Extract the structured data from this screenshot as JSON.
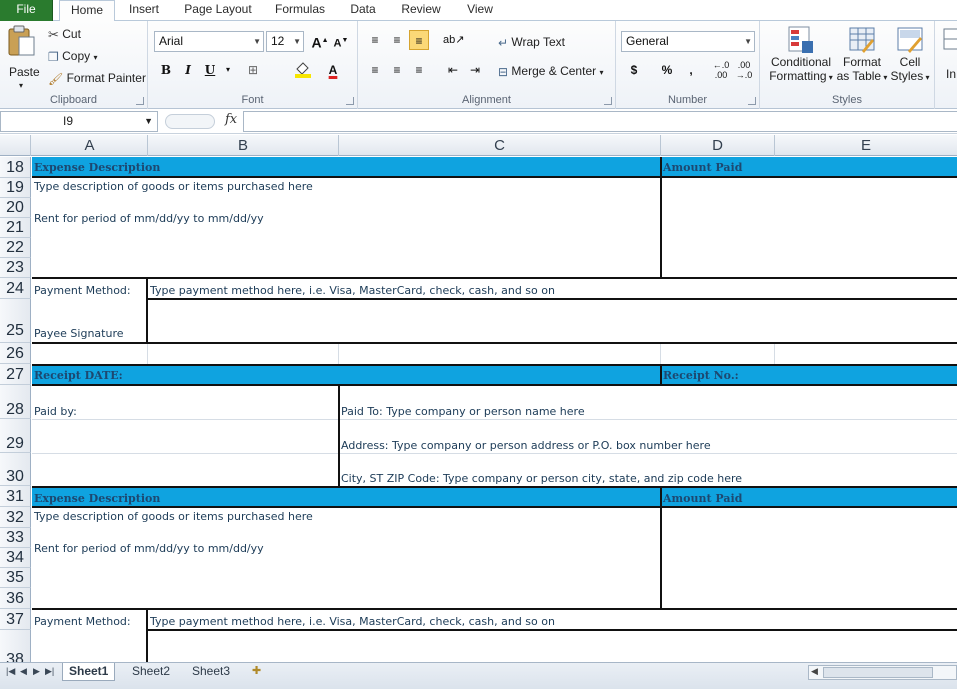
{
  "ribbon_tabs": [
    "File",
    "Home",
    "Insert",
    "Page Layout",
    "Formulas",
    "Data",
    "Review",
    "View"
  ],
  "clipboard": {
    "paste": "Paste",
    "cut": "Cut",
    "copy": "Copy",
    "format_painter": "Format Painter",
    "label": "Clipboard"
  },
  "font": {
    "name": "Arial",
    "size": "12",
    "bold": "B",
    "italic": "I",
    "underline": "U",
    "label": "Font"
  },
  "alignment": {
    "wrap": "Wrap Text",
    "merge": "Merge & Center",
    "label": "Alignment"
  },
  "number": {
    "format": "General",
    "currency": "$",
    "percent": "%",
    "comma": ",",
    "label": "Number"
  },
  "styles": {
    "conditional_1": "Conditional",
    "conditional_2": "Formatting",
    "format_table_1": "Format",
    "format_table_2": "as Table",
    "cell_styles_1": "Cell",
    "cell_styles_2": "Styles",
    "label": "Styles",
    "insert_cut": "In"
  },
  "formula_bar": {
    "name_box": "I9",
    "fx": "fx",
    "formula": ""
  },
  "columns": [
    "A",
    "B",
    "C",
    "D",
    "E"
  ],
  "rows": [
    "18",
    "19",
    "20",
    "21",
    "22",
    "23",
    "24",
    "25",
    "26",
    "27",
    "28",
    "29",
    "30",
    "31",
    "32",
    "33",
    "34",
    "35",
    "36",
    "37",
    "38"
  ],
  "cells": {
    "expense_desc_1": "Expense Description",
    "amount_paid_1": "Amount Paid",
    "desc_hint_1": "Type description of goods or items purchased here",
    "rent_1": "Rent for period of mm/dd/yy to mm/dd/yy",
    "payment_method_label_1": "Payment Method:",
    "payment_method_hint_1": "Type payment method here, i.e. Visa, MasterCard, check, cash, and so on",
    "payee_signature": "Payee Signature",
    "receipt_date": "Receipt DATE:",
    "receipt_no": "Receipt No.:",
    "paid_by": "Paid by:",
    "paid_to": "Paid To:   Type company or person name here",
    "address": "Address:  Type company or person address or P.O. box number here",
    "city": "City, ST  ZIP Code:  Type company or person city, state, and zip code here",
    "expense_desc_2": "Expense Description",
    "amount_paid_2": "Amount Paid",
    "desc_hint_2": "Type description of goods or items purchased here",
    "rent_2": "Rent for period of mm/dd/yy to mm/dd/yy",
    "payment_method_label_2": "Payment Method:",
    "payment_method_hint_2": "Type payment method here, i.e. Visa, MasterCard, check, cash, and so on"
  },
  "sheets": [
    "Sheet1",
    "Sheet2",
    "Sheet3"
  ],
  "colors": {
    "header_fill": "#0fa3e0",
    "file_tab": "#2a7b2e"
  }
}
